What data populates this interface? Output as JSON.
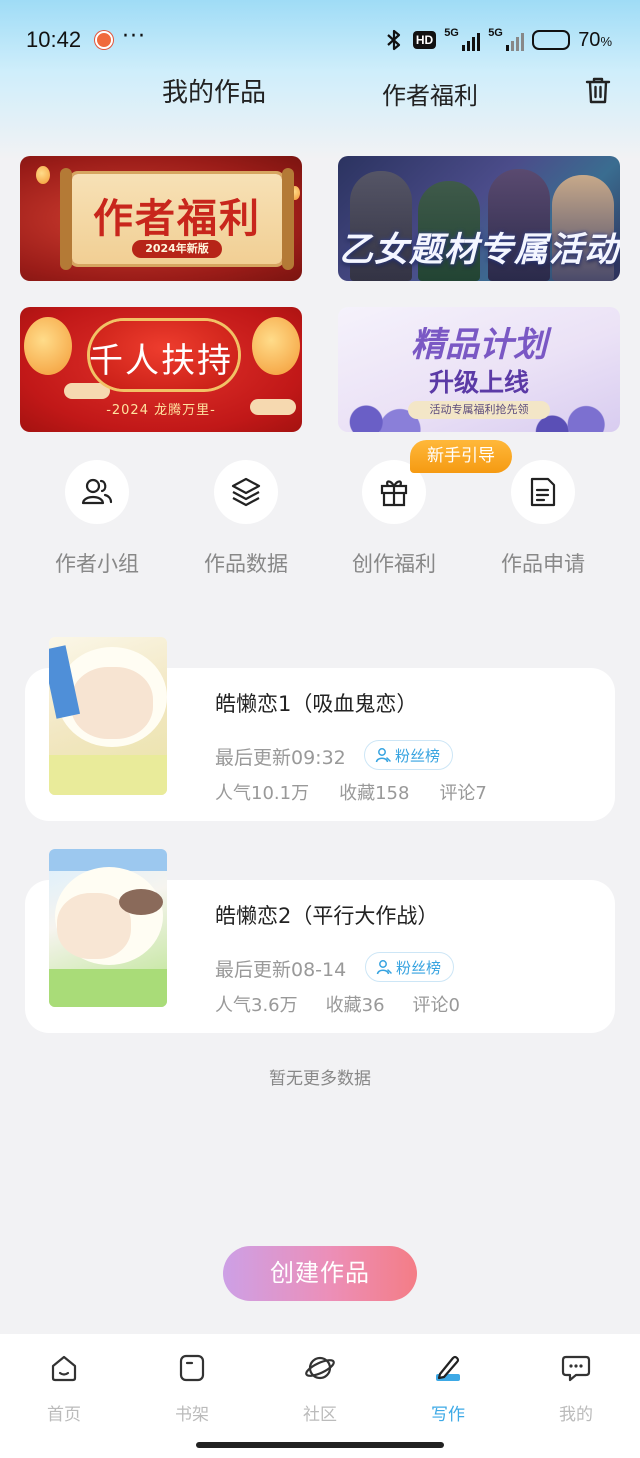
{
  "status_bar": {
    "time": "10:42",
    "more": "···",
    "hd_badge": "HD",
    "signal_1_label": "5G",
    "signal_2_label": "5G",
    "battery_percent": "70",
    "battery_unit": "%",
    "battery_level": 0.7
  },
  "header": {
    "tab_mine": "我的作品",
    "tab_welfare": "作者福利",
    "trash_icon": "trash-icon"
  },
  "banners": [
    {
      "title": "作者福利",
      "subtitle": "2024年新版"
    },
    {
      "title": "乙女题材专属活动"
    },
    {
      "title": "千人扶持",
      "subtitle": "-2024 龙腾万里-"
    },
    {
      "title": "精品计划",
      "subtitle": "升级上线",
      "tag": "活动专属福利抢先领"
    }
  ],
  "shortcuts": [
    {
      "label": "作者小组",
      "icon": "users-icon"
    },
    {
      "label": "作品数据",
      "icon": "layers-icon"
    },
    {
      "label": "创作福利",
      "icon": "gift-icon"
    },
    {
      "label": "作品申请",
      "icon": "document-icon"
    }
  ],
  "newbie_badge": "新手引导",
  "works": [
    {
      "title": "皓懒恋1（吸血鬼恋）",
      "updated": "最后更新09:32",
      "fan_label": "粉丝榜",
      "popularity": "人气10.1万",
      "favorites": "收藏158",
      "comments": "评论7"
    },
    {
      "title": "皓懒恋2（平行大作战）",
      "updated": "最后更新08-14",
      "fan_label": "粉丝榜",
      "popularity": "人气3.6万",
      "favorites": "收藏36",
      "comments": "评论0"
    }
  ],
  "no_more_text": "暂无更多数据",
  "create_button": "创建作品",
  "bottom_nav": [
    {
      "label": "首页",
      "icon": "home-icon",
      "active": false
    },
    {
      "label": "书架",
      "icon": "bookshelf-icon",
      "active": false
    },
    {
      "label": "社区",
      "icon": "planet-icon",
      "active": false
    },
    {
      "label": "写作",
      "icon": "pen-icon",
      "active": true
    },
    {
      "label": "我的",
      "icon": "chat-bubble-icon",
      "active": false
    }
  ],
  "colors": {
    "accent": "#3da9e6",
    "badge_orange": "#f59a12",
    "create_gradient_start": "#cda0e6",
    "create_gradient_end": "#f47d86"
  }
}
